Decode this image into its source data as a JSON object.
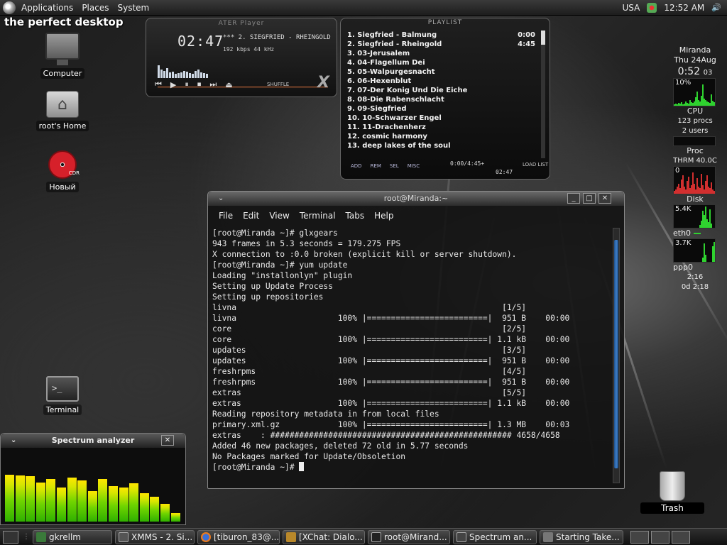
{
  "top_panel": {
    "menus": [
      "Applications",
      "Places",
      "System"
    ],
    "keyboard": "USA",
    "clock": "12:52 AM"
  },
  "desktop": {
    "title": "the perfect desktop",
    "icons": [
      "Computer",
      "root's Home",
      "Новый",
      "Terminal"
    ],
    "trash": "Trash"
  },
  "xmms": {
    "title": "ATER Player",
    "time": "02:47",
    "song": "***  2. SIEGFRIED - RHEINGOLD",
    "bitrate": "192 kbps  44 kHz",
    "shuffle": "SHUFFLE"
  },
  "playlist": {
    "title": "PLAYLIST",
    "tracks": [
      {
        "name": "1. Siegfried - Balmung",
        "len": "0:00"
      },
      {
        "name": "2. Siegfried - Rheingold",
        "len": "4:45"
      },
      {
        "name": "3. 03-Jerusalem",
        "len": ""
      },
      {
        "name": "4. 04-Flagellum Dei",
        "len": ""
      },
      {
        "name": "5. 05-Walpurgesnacht",
        "len": ""
      },
      {
        "name": "6. 06-Hexenblut",
        "len": ""
      },
      {
        "name": "7. 07-Der Konig Und Die Eiche",
        "len": ""
      },
      {
        "name": "8. 08-Die Rabenschlacht",
        "len": ""
      },
      {
        "name": "9. 09-Siegfried",
        "len": ""
      },
      {
        "name": "10. 10-Schwarzer Engel",
        "len": ""
      },
      {
        "name": "11. 11-Drachenherz",
        "len": ""
      },
      {
        "name": "12. cosmic harmony",
        "len": ""
      },
      {
        "name": "13. deep lakes of the soul",
        "len": ""
      }
    ],
    "buttons": [
      "ADD",
      "REM",
      "SEL",
      "MISC"
    ],
    "total": "0:00/4:45+",
    "elapsed": "02:47",
    "load_list": "LOAD LIST"
  },
  "terminal": {
    "title": "root@Miranda:~",
    "menus": [
      "File",
      "Edit",
      "View",
      "Terminal",
      "Tabs",
      "Help"
    ],
    "lines": [
      "[root@Miranda ~]# glxgears",
      "943 frames in 5.3 seconds = 179.275 FPS",
      "X connection to :0.0 broken (explicit kill or server shutdown).",
      "[root@Miranda ~]# yum update",
      "Loading \"installonlyn\" plugin",
      "Setting up Update Process",
      "Setting up repositories",
      "livna                                                       [1/5]",
      "livna                     100% |=========================|  951 B    00:00",
      "core                                                        [2/5]",
      "core                      100% |=========================| 1.1 kB    00:00",
      "updates                                                     [3/5]",
      "updates                   100% |=========================|  951 B    00:00",
      "freshrpms                                                   [4/5]",
      "freshrpms                 100% |=========================|  951 B    00:00",
      "extras                                                      [5/5]",
      "extras                    100% |=========================| 1.1 kB    00:00",
      "Reading repository metadata in from local files",
      "primary.xml.gz            100% |=========================| 1.3 MB    00:03",
      "extras    : ################################################## 4658/4658",
      "Added 46 new packages, deleted 72 old in 5.77 seconds",
      "No Packages marked for Update/Obsoletion"
    ],
    "prompt": "[root@Miranda ~]# "
  },
  "spectrum": {
    "title": "Spectrum analyzer",
    "levels": [
      0.66,
      0.65,
      0.64,
      0.55,
      0.6,
      0.48,
      0.62,
      0.58,
      0.43,
      0.6,
      0.5,
      0.48,
      0.54,
      0.4,
      0.35,
      0.25,
      0.12
    ]
  },
  "gkrellm": {
    "host": "Miranda",
    "date": "Thu 24Aug",
    "time": "0:52",
    "seconds": "03",
    "cpu_pct": "10%",
    "cpu_label": "CPU",
    "procs": "123 procs",
    "users": "2 users",
    "proc_label": "Proc",
    "thrm": "THRM 40.0C",
    "thrm_zero": "0",
    "disk_label": "Disk",
    "disk_rate": "5.4K",
    "eth0": "eth0",
    "eth0_rate": "3.7K",
    "ppp0": "ppp0",
    "ppp0_time": "2:16",
    "ppp0_total": "0d 2:18"
  },
  "taskbar": [
    "gkrellm",
    "XMMS - 2. Si...",
    "[tiburon_83@...",
    "[XChat: Dialo...",
    "root@Mirand...",
    "Spectrum an...",
    "Starting Take..."
  ],
  "colors": {
    "accent_green": "#2fd22f",
    "cd_red": "#d6202a",
    "scroll_blue": "#3f7fc8"
  }
}
